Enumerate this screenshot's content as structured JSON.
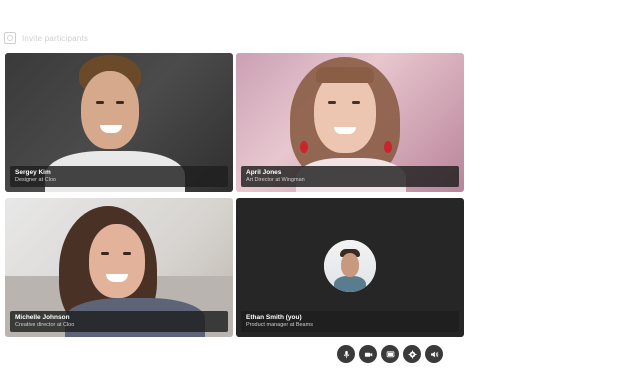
{
  "topbar": {
    "label": "Invite participants"
  },
  "participants": [
    {
      "name": "Sergey Kim",
      "role": "Designer at Cloo"
    },
    {
      "name": "April Jones",
      "role": "Art Director at Wingman"
    },
    {
      "name": "Michelle Johnson",
      "role": "Creative director at Cloo"
    },
    {
      "name": "Ethan Smith (you)",
      "role": "Product manager at Beams"
    }
  ],
  "controls": [
    "microphone-icon",
    "camera-icon",
    "screen-share-icon",
    "settings-icon",
    "volume-icon"
  ]
}
